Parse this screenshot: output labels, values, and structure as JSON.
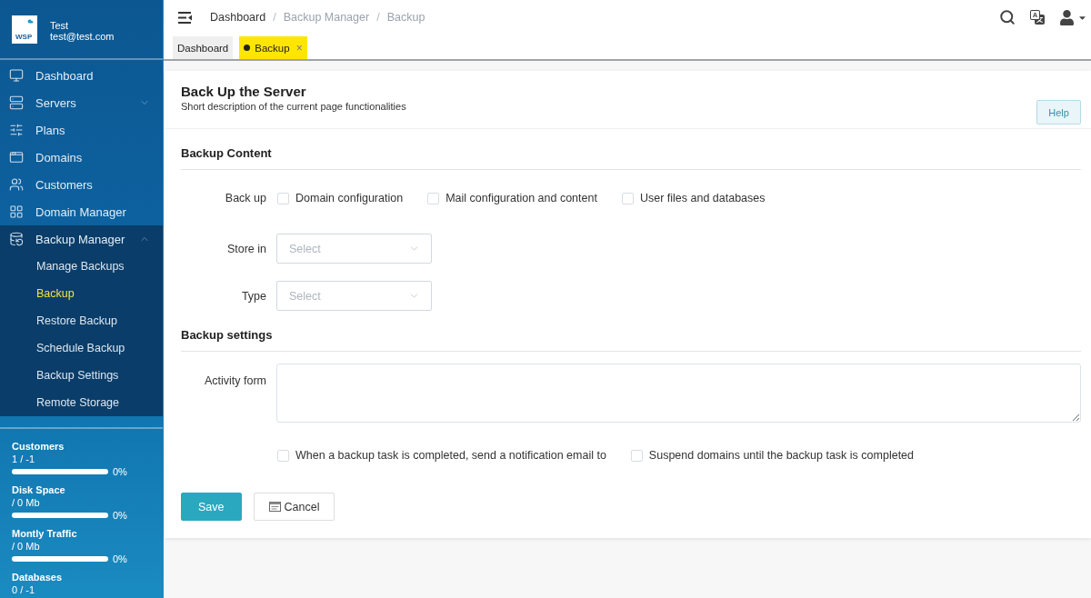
{
  "sidebar": {
    "account": {
      "logo": "WSP",
      "name": "Test",
      "email": "test@test.com"
    },
    "menu": [
      {
        "label": "Dashboard",
        "kind": "link"
      },
      {
        "label": "Servers",
        "kind": "group",
        "expanded": false
      },
      {
        "label": "Plans",
        "kind": "link"
      },
      {
        "label": "Domains",
        "kind": "link"
      },
      {
        "label": "Customers",
        "kind": "link"
      },
      {
        "label": "Domain Manager",
        "kind": "link"
      },
      {
        "label": "Backup Manager",
        "kind": "group",
        "expanded": true,
        "children": [
          {
            "label": "Manage Backups",
            "selected": false
          },
          {
            "label": "Backup",
            "selected": true
          },
          {
            "label": "Restore Backup",
            "selected": false
          },
          {
            "label": "Schedule Backup",
            "selected": false
          },
          {
            "label": "Backup Settings",
            "selected": false
          },
          {
            "label": "Remote Storage",
            "selected": false
          }
        ]
      }
    ],
    "usage": [
      {
        "label": "Customers",
        "value": "1 / -1",
        "level": 0,
        "percent": "0%"
      },
      {
        "label": "Disk Space",
        "value": "/ 0 Mb",
        "level": 0,
        "percent": "0%"
      },
      {
        "label": "Montly Traffic",
        "value": "/ 0 Mb",
        "level": 0,
        "percent": "0%"
      },
      {
        "label": "Databases",
        "value": "0 / -1"
      }
    ]
  },
  "topbar": {
    "breadcrumb": [
      {
        "label": "Dashboard",
        "kind": "link"
      },
      {
        "label": "/",
        "kind": "separator"
      },
      {
        "label": "Backup Manager",
        "kind": "text"
      },
      {
        "label": "/",
        "kind": "separator"
      },
      {
        "label": "Backup",
        "kind": "text"
      }
    ]
  },
  "tabs": [
    {
      "label": "Dashboard",
      "selected": false
    },
    {
      "label": "Backup",
      "selected": true,
      "close": "×"
    }
  ],
  "page": {
    "title": "Back Up the Server",
    "description": "Short description of the current page functionalities",
    "help": "Help",
    "sections": [
      {
        "title": "Backup Content",
        "fields": [
          {
            "kind": "checkboxes",
            "label": "Back up",
            "options": [
              {
                "label": "Domain configuration",
                "checked": false
              },
              {
                "label": "Mail configuration and content",
                "checked": false
              },
              {
                "label": "User files and databases",
                "checked": false
              }
            ]
          },
          {
            "kind": "select",
            "label": "Store in",
            "placeholder": "Select"
          },
          {
            "kind": "select",
            "label": "Type",
            "placeholder": "Select"
          }
        ]
      },
      {
        "title": "Backup settings",
        "fields": [
          {
            "kind": "textarea",
            "label": "Activity form"
          },
          {
            "kind": "checkboxes",
            "options": [
              {
                "label": "When a backup task is completed, send a notification email to",
                "checked": false
              },
              {
                "label": "Suspend domains until the backup task is completed",
                "checked": false
              }
            ]
          }
        ]
      }
    ],
    "actions": [
      {
        "label": "Save",
        "kind": "primary"
      },
      {
        "label": "Cancel",
        "kind": "secondary"
      }
    ]
  }
}
